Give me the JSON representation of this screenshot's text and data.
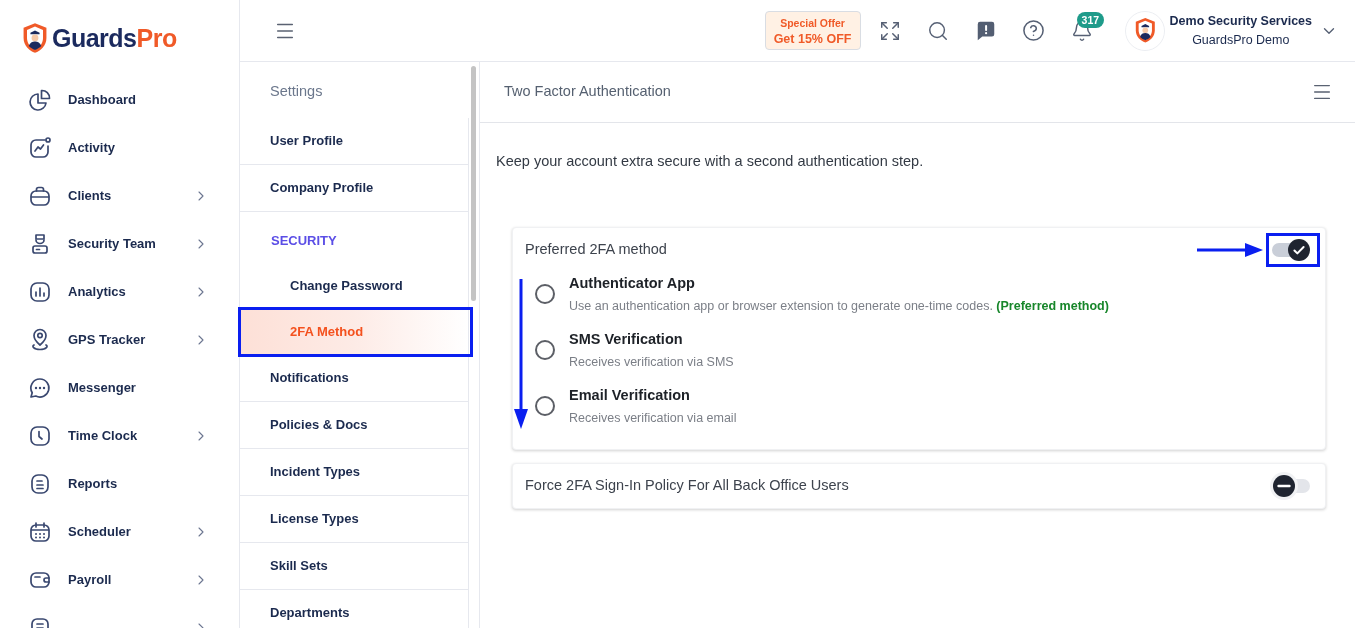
{
  "logo": {
    "text_main": "Guards",
    "text_accent": "Pro"
  },
  "sidebar": {
    "items": [
      {
        "label": "Dashboard",
        "expandable": false
      },
      {
        "label": "Activity",
        "expandable": false
      },
      {
        "label": "Clients",
        "expandable": true
      },
      {
        "label": "Security Team",
        "expandable": true
      },
      {
        "label": "Analytics",
        "expandable": true
      },
      {
        "label": "GPS Tracker",
        "expandable": true
      },
      {
        "label": "Messenger",
        "expandable": false
      },
      {
        "label": "Time Clock",
        "expandable": true
      },
      {
        "label": "Reports",
        "expandable": false
      },
      {
        "label": "Scheduler",
        "expandable": true
      },
      {
        "label": "Payroll",
        "expandable": true
      },
      {
        "expandable": true
      }
    ]
  },
  "topbar": {
    "offer": {
      "line_1": "Special Offer",
      "line_2": "Get 15% OFF"
    },
    "notification_count": "317",
    "account": {
      "name": "Demo Security Services",
      "organization": "GuardsPro Demo"
    }
  },
  "settings": {
    "title": "Settings",
    "items": [
      {
        "kind": "link",
        "label": "User Profile",
        "selected": false
      },
      {
        "kind": "link",
        "label": "Company Profile",
        "selected": false
      },
      {
        "kind": "section",
        "label": "SECURITY"
      },
      {
        "kind": "sublink",
        "label": "Change Password",
        "selected": false
      },
      {
        "kind": "sublink",
        "label": "2FA Method",
        "selected": true
      },
      {
        "kind": "link",
        "label": "Notifications",
        "selected": false
      },
      {
        "kind": "link",
        "label": "Policies & Docs",
        "selected": false
      },
      {
        "kind": "link",
        "label": "Incident Types",
        "selected": false
      },
      {
        "kind": "link",
        "label": "License Types",
        "selected": false
      },
      {
        "kind": "link",
        "label": "Skill Sets",
        "selected": false
      },
      {
        "kind": "link",
        "label": "Departments",
        "selected": false
      }
    ]
  },
  "main": {
    "title": "Two Factor Authentication",
    "intro": "Keep your account extra secure with a second authentication step.",
    "method_card": {
      "title": "Preferred 2FA method",
      "enabled": true,
      "options": [
        {
          "title": "Authenticator App",
          "description": "Use an authentication app or browser extension to generate one-time codes.",
          "note": "(Preferred method)",
          "selected": false
        },
        {
          "title": "SMS Verification",
          "description": "Receives verification via SMS",
          "selected": false
        },
        {
          "title": "Email Verification",
          "description": "Receives verification via email",
          "selected": false
        }
      ]
    },
    "policy_card": {
      "title": "Force 2FA Sign-In Policy For All Back Office Users",
      "enabled": false
    }
  }
}
